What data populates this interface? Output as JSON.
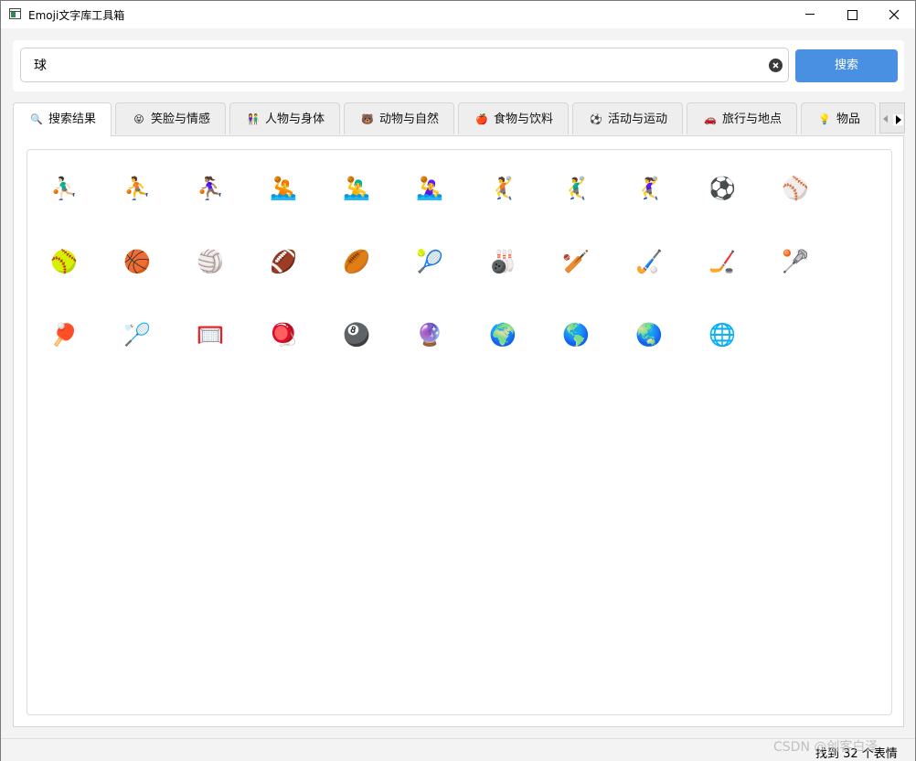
{
  "window": {
    "title": "Emoji文字库工具箱"
  },
  "search": {
    "value": "球",
    "button_label": "搜索"
  },
  "tabs": [
    {
      "icon": "🔍",
      "label": "搜索结果"
    },
    {
      "icon": "😝",
      "label": "笑脸与情感"
    },
    {
      "icon": "👫",
      "label": "人物与身体"
    },
    {
      "icon": "🐻",
      "label": "动物与自然"
    },
    {
      "icon": "🍎",
      "label": "食物与饮料"
    },
    {
      "icon": "⚽",
      "label": "活动与运动"
    },
    {
      "icon": "🚗",
      "label": "旅行与地点"
    },
    {
      "icon": "💡",
      "label": "物品"
    }
  ],
  "active_tab": 0,
  "results": [
    "⛹🏻‍♂️",
    "⛹️",
    "⛹🏽‍♀️",
    "🤽",
    "🤽‍♂️",
    "🤽‍♀️",
    "🤾",
    "🤾‍♂️",
    "🤾‍♀️",
    "⚽",
    "⚾",
    "🥎",
    "🏀",
    "🏐",
    "🏈",
    "🏉",
    "🎾",
    "🎳",
    "🏏",
    "🏑",
    "🏒",
    "🥍",
    "🏓",
    "🏸",
    "🥅",
    "🪀",
    "🎱",
    "🔮",
    "🌍",
    "🌎",
    "🌏",
    "🌐"
  ],
  "status": {
    "text": "找到 32 个表情"
  },
  "watermark": "CSDN @创客白泽",
  "colors": {
    "accent": "#4a90e2",
    "tab_active_bg": "#ffffff",
    "tab_bg": "#eeeeee"
  }
}
